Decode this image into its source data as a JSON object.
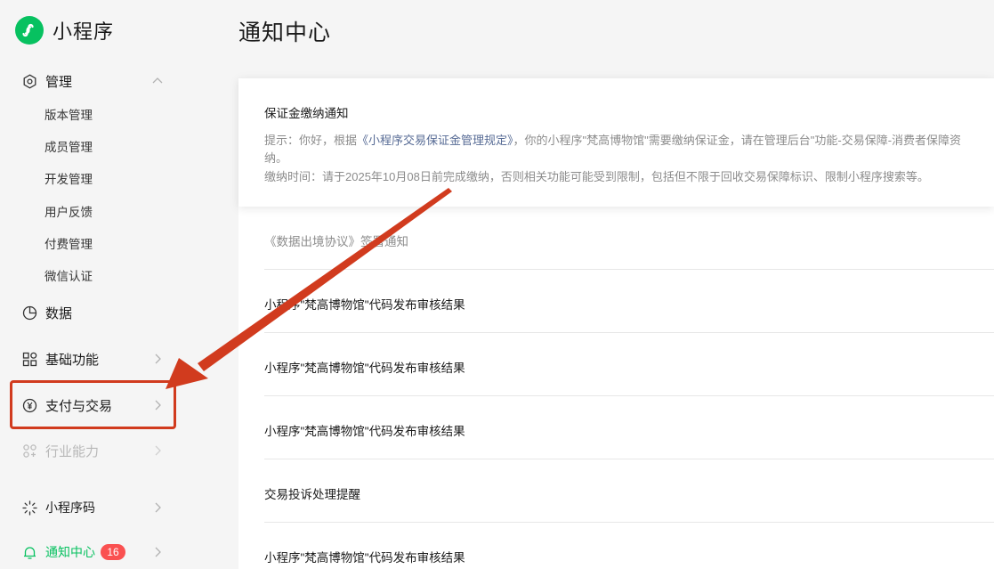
{
  "brand": {
    "name": "小程序"
  },
  "page": {
    "title": "通知中心"
  },
  "sidebar": {
    "manage": {
      "label": "管理",
      "icon": "gear-icon"
    },
    "manage_items": [
      "版本管理",
      "成员管理",
      "开发管理",
      "用户反馈",
      "付费管理",
      "微信认证"
    ],
    "data": {
      "label": "数据",
      "icon": "pie-chart-icon"
    },
    "basic": {
      "label": "基础功能",
      "icon": "grid-icon"
    },
    "pay": {
      "label": "支付与交易",
      "icon": "yen-coin-icon"
    },
    "industry": {
      "label": "行业能力",
      "icon": "industry-icon"
    },
    "qrcode": {
      "label": "小程序码",
      "icon": "qrcode-icon"
    },
    "notify": {
      "label": "通知中心",
      "badge": "16",
      "icon": "bell-icon"
    }
  },
  "notice": {
    "title": "保证金缴纳通知",
    "line1_prefix": "提示：你好，根据",
    "line1_link": "《小程序交易保证金管理规定》",
    "line1_suffix": "，你的小程序\"梵高博物馆\"需要缴纳保证金，请在管理后台\"功能-交易保障-消费者保障资",
    "line2": "纳。",
    "line3": "缴纳时间：请于2025年10月08日前完成缴纳，否则相关功能可能受到限制，包括但不限于回收交易保障标识、限制小程序搜索等。"
  },
  "list": [
    {
      "text": "《数据出境协议》签署通知"
    },
    {
      "text": "小程序\"梵高博物馆\"代码发布审核结果"
    },
    {
      "text": "小程序\"梵高博物馆\"代码发布审核结果"
    },
    {
      "text": "小程序\"梵高博物馆\"代码发布审核结果"
    },
    {
      "text": "交易投诉处理提醒"
    },
    {
      "text": "小程序\"梵高博物馆\"代码发布审核结果"
    }
  ],
  "colors": {
    "brand": "#07c160",
    "annotation": "#d13b1e",
    "badge": "#fa5151",
    "link": "#576b95"
  }
}
